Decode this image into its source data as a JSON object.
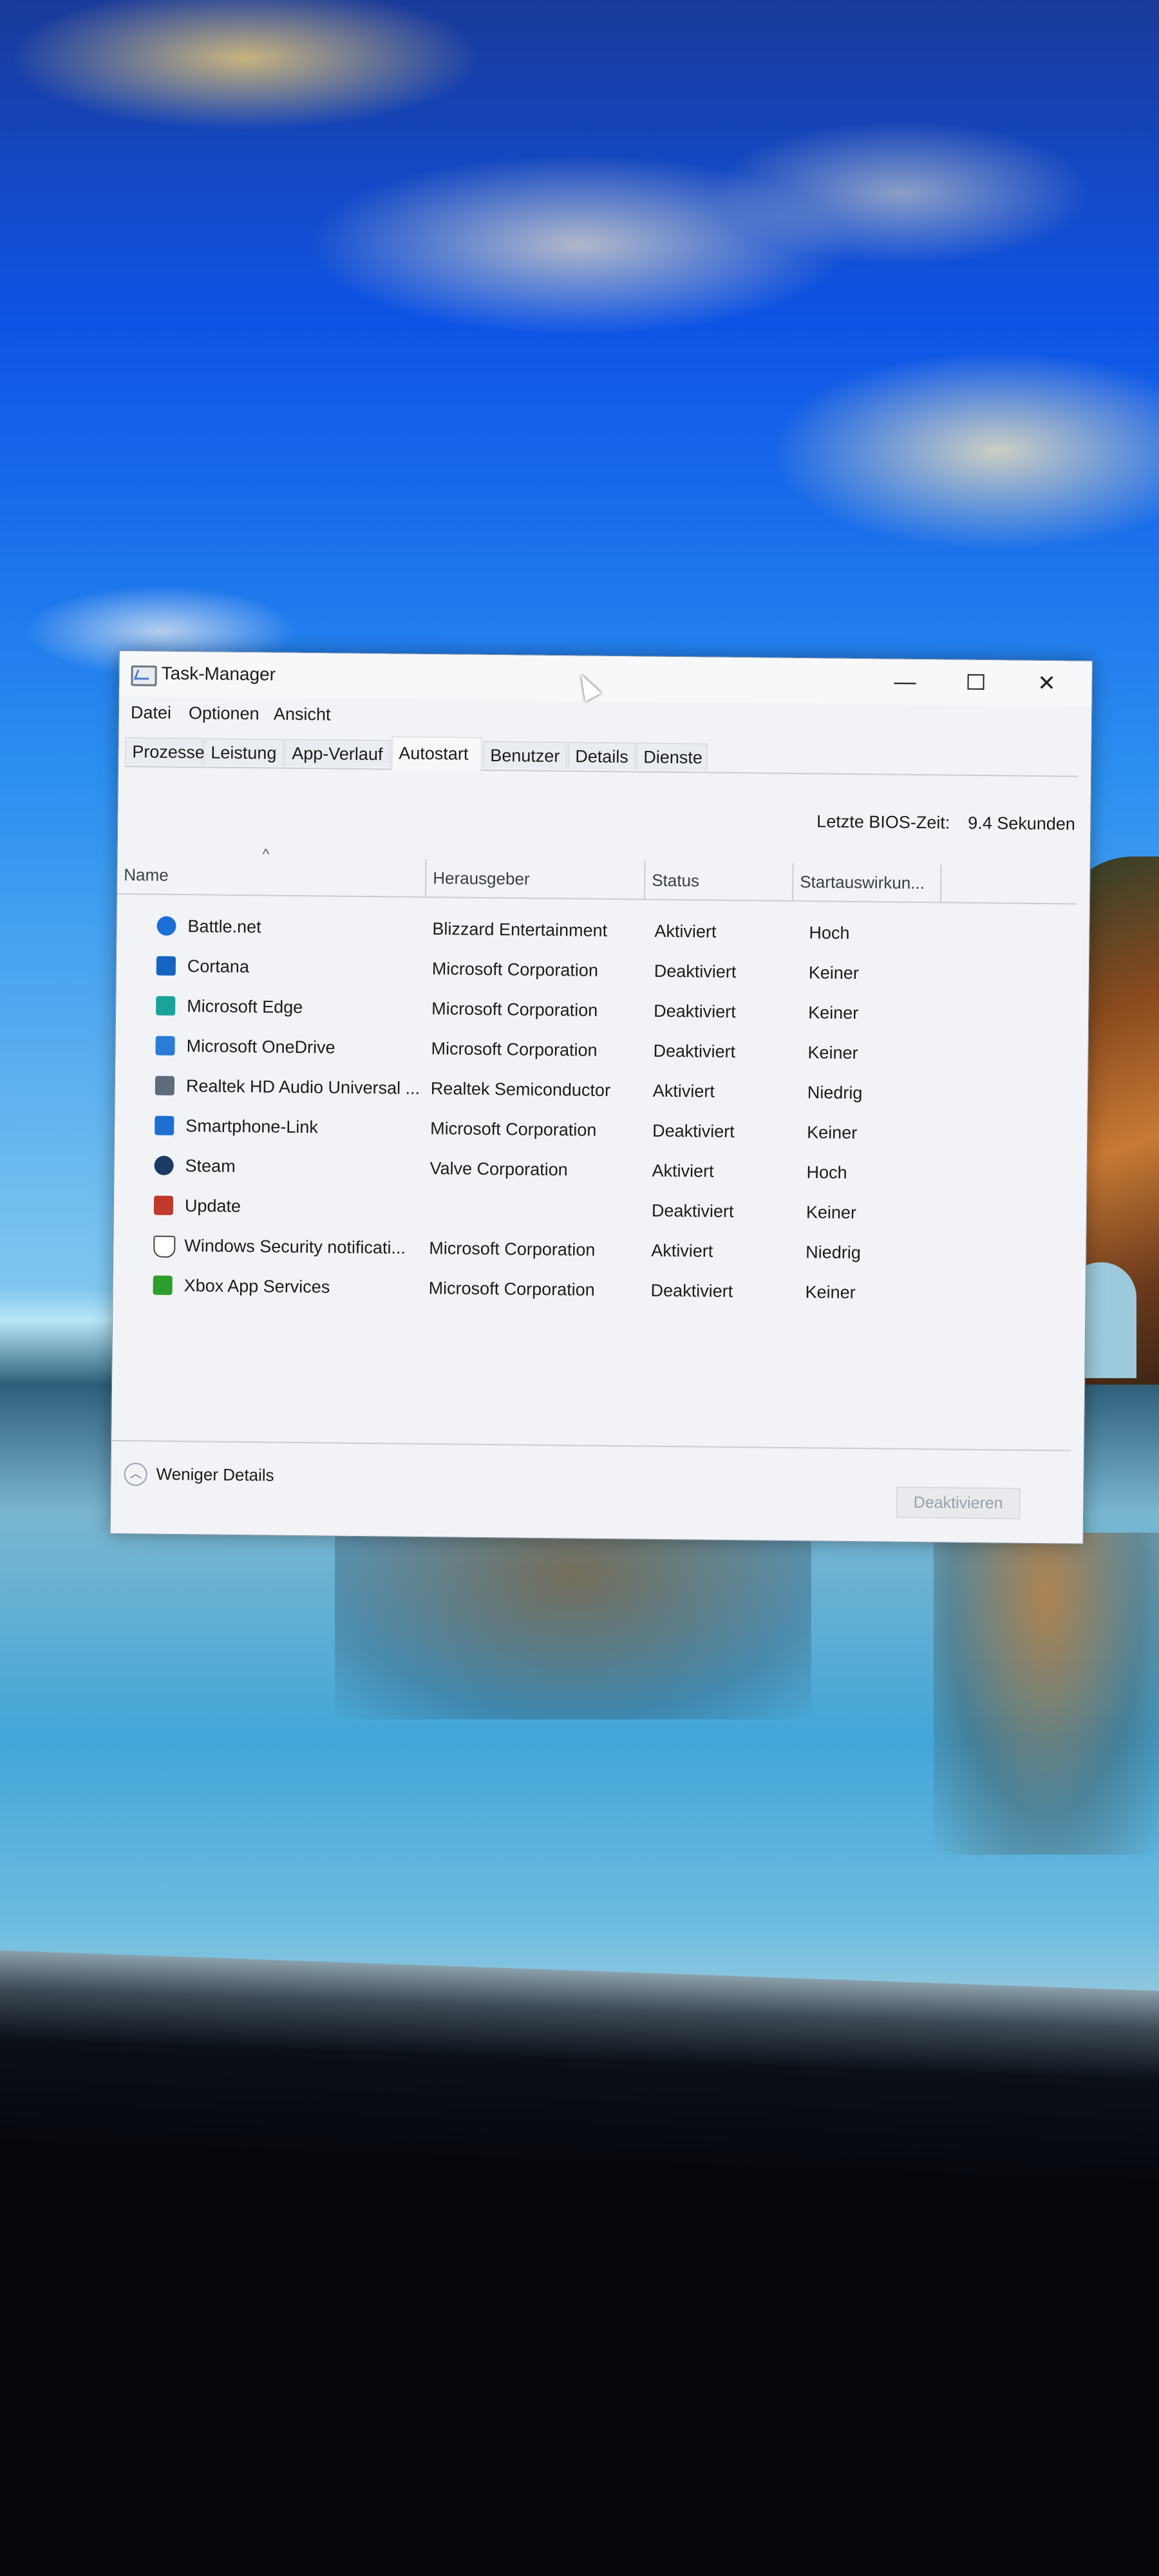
{
  "window": {
    "title": "Task-Manager",
    "controls": {
      "minimize": "—",
      "maximize": "",
      "close": "✕"
    }
  },
  "menu": [
    "Datei",
    "Optionen",
    "Ansicht"
  ],
  "tabs": [
    "Prozesse",
    "Leistung",
    "App-Verlauf",
    "Autostart",
    "Benutzer",
    "Details",
    "Dienste"
  ],
  "active_tab": "Autostart",
  "bios": {
    "label": "Letzte BIOS-Zeit:",
    "value": "9.4 Sekunden"
  },
  "columns": {
    "name": "Name",
    "publisher": "Herausgeber",
    "status": "Status",
    "impact": "Startauswirkun..."
  },
  "rows": [
    {
      "name": "Battle.net",
      "publisher": "Blizzard Entertainment",
      "status": "Aktiviert",
      "impact": "Hoch",
      "icon": "battlenet-icon",
      "color": "#1c6fd6"
    },
    {
      "name": "Cortana",
      "publisher": "Microsoft Corporation",
      "status": "Deaktiviert",
      "impact": "Keiner",
      "icon": "cortana-icon",
      "color": "#1565c0"
    },
    {
      "name": "Microsoft Edge",
      "publisher": "Microsoft Corporation",
      "status": "Deaktiviert",
      "impact": "Keiner",
      "icon": "edge-icon",
      "color": "#1aa39a"
    },
    {
      "name": "Microsoft OneDrive",
      "publisher": "Microsoft Corporation",
      "status": "Deaktiviert",
      "impact": "Keiner",
      "icon": "onedrive-icon",
      "color": "#2b7cd3"
    },
    {
      "name": "Realtek HD Audio Universal ...",
      "publisher": "Realtek Semiconductor",
      "status": "Aktiviert",
      "impact": "Niedrig",
      "icon": "realtek-icon",
      "color": "#5f6b7a"
    },
    {
      "name": "Smartphone-Link",
      "publisher": "Microsoft Corporation",
      "status": "Deaktiviert",
      "impact": "Keiner",
      "icon": "phone-link-icon",
      "color": "#1f6fd1"
    },
    {
      "name": "Steam",
      "publisher": "Valve Corporation",
      "status": "Aktiviert",
      "impact": "Hoch",
      "icon": "steam-icon",
      "color": "#1b3a66"
    },
    {
      "name": "Update",
      "publisher": "",
      "status": "Deaktiviert",
      "impact": "Keiner",
      "icon": "update-icon",
      "color": "#c0392b"
    },
    {
      "name": "Windows Security notificati...",
      "publisher": "Microsoft Corporation",
      "status": "Aktiviert",
      "impact": "Niedrig",
      "icon": "shield-icon",
      "color": "#ffffff"
    },
    {
      "name": "Xbox App Services",
      "publisher": "Microsoft Corporation",
      "status": "Deaktiviert",
      "impact": "Keiner",
      "icon": "xbox-icon",
      "color": "#2e9e2e"
    }
  ],
  "footer": {
    "less_details": "Weniger Details",
    "deactivate": "Deaktivieren"
  }
}
